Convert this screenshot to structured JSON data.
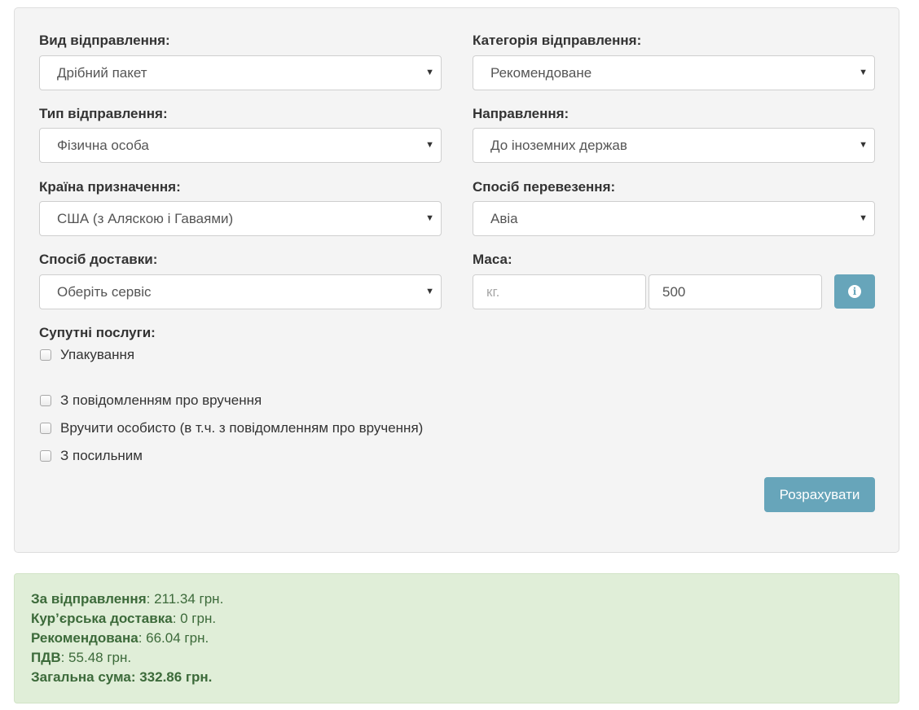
{
  "form": {
    "shipment_kind": {
      "label": "Вид відправлення:",
      "value": "Дрібний пакет"
    },
    "shipment_category": {
      "label": "Категорія відправлення:",
      "value": "Рекомендоване"
    },
    "shipment_type": {
      "label": "Тип відправлення:",
      "value": "Фізична особа"
    },
    "direction": {
      "label": "Направлення:",
      "value": "До іноземних держав"
    },
    "destination_country": {
      "label": "Країна призначення:",
      "value": "США (з Аляскою і Гаваями)"
    },
    "transport_method": {
      "label": "Спосіб перевезення:",
      "value": "Авіа"
    },
    "delivery_method": {
      "label": "Спосіб доставки:",
      "value": "Оберіть сервіс"
    },
    "mass": {
      "label": "Маса:",
      "kg_placeholder": "кг.",
      "grams_value": "500",
      "info_icon": "info-icon"
    },
    "services": {
      "label": "Супутні послуги:",
      "items": [
        {
          "label": "Упакування",
          "checked": false
        },
        {
          "label": "З повідомленням про вручення",
          "checked": false
        },
        {
          "label": "Вручити особисто (в т.ч. з повідомленням про вручення)",
          "checked": false
        },
        {
          "label": "З посильним",
          "checked": false
        }
      ]
    },
    "calculate_label": "Розрахувати"
  },
  "result": {
    "shipment": {
      "label": "За відправлення",
      "value": ": 211.34 грн."
    },
    "courier": {
      "label": "Кур’єрська доставка",
      "value": ": 0 грн."
    },
    "registered": {
      "label": "Рекомендована",
      "value": ": 66.04 грн."
    },
    "vat": {
      "label": "ПДВ",
      "value": ": 55.48 грн."
    },
    "total": {
      "label": "Загальна сума: 332.86 грн."
    }
  },
  "colors": {
    "accent_button": "#67a5ba",
    "success_bg": "#e0eed8",
    "success_text": "#3c6a3a"
  }
}
